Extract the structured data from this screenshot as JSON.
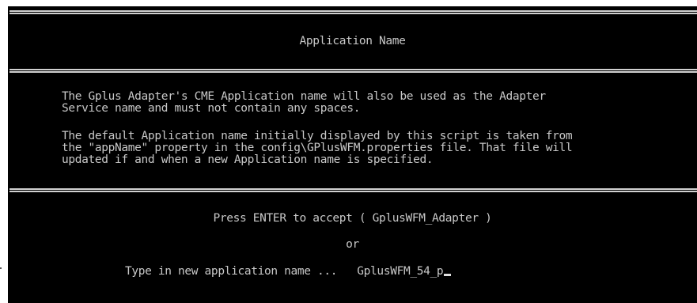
{
  "header": {
    "title": "Application Name"
  },
  "description": {
    "paragraph_1": "The Gplus Adapter's CME Application name will also be used as the Adapter\nService name and must not contain any spaces.",
    "paragraph_2": "The default Application name initially displayed by this script is taken from\nthe \"appName\" property in the config\\GPlusWFM.properties file. That file will\nupdated if and when a new Application name is specified."
  },
  "prompt": {
    "accept_text": "Press ENTER to accept ( GplusWFM_Adapter )",
    "or_text": "or",
    "type_label": "Type in new application name ...",
    "input_value": "GplusWFM_54_p"
  }
}
